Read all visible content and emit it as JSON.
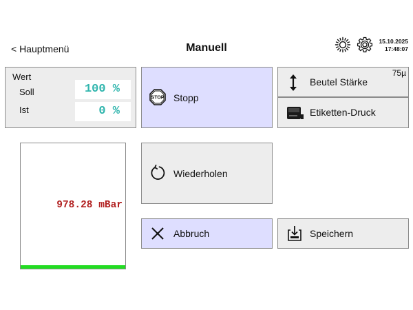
{
  "header": {
    "back_label": "< Hauptmenü",
    "title": "Manuell",
    "date": "15.10.2025",
    "time": "17:48:07",
    "icons": [
      "sun-icon",
      "gear-icon"
    ]
  },
  "wert_panel": {
    "title": "Wert",
    "soll_label": "Soll",
    "soll_value": "100 %",
    "ist_label": "Ist",
    "ist_value": "0 %"
  },
  "buttons": {
    "stopp": {
      "label": "Stopp",
      "icon": "stop-sign-icon",
      "icon_text": "STOP"
    },
    "beutel": {
      "label": "Beutel Stärke",
      "icon": "up-down-arrow-icon",
      "value": "75µ"
    },
    "etiketten": {
      "label": "Etiketten-Druck",
      "icon": "label-printer-icon"
    },
    "wiederholen": {
      "label": "Wiederholen",
      "icon": "repeat-icon"
    },
    "abbruch": {
      "label": "Abbruch",
      "icon": "close-icon"
    },
    "speichern": {
      "label": "Speichern",
      "icon": "save-icon"
    }
  },
  "gauge": {
    "value_text": "978.28 mBar",
    "fill_fraction": 0.03
  },
  "colors": {
    "panel_gray": "#ededed",
    "panel_blue": "#dedeff",
    "value_teal": "#2fb5ad",
    "pressure_red": "#b22222",
    "gauge_green": "#22dd22"
  }
}
